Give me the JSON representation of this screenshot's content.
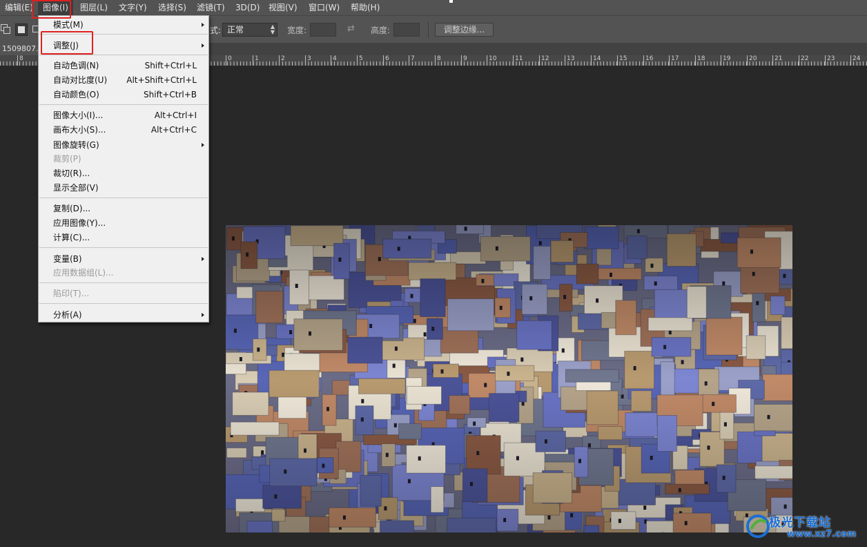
{
  "menubar": {
    "items": [
      "编辑(E)",
      "图像(I)",
      "图层(L)",
      "文字(Y)",
      "选择(S)",
      "滤镜(T)",
      "3D(D)",
      "视图(V)",
      "窗口(W)",
      "帮助(H)"
    ],
    "active_index": 1
  },
  "options": {
    "style_tail": "式:",
    "style_value": "正常",
    "width_label": "宽度:",
    "height_label": "高度:",
    "refine_edge": "调整边缘..."
  },
  "document": {
    "tab_title": "1509807..."
  },
  "ruler": {
    "numbers": [
      "8",
      "0",
      "1",
      "2",
      "3",
      "4",
      "5",
      "6",
      "7",
      "8",
      "9",
      "10",
      "11",
      "12",
      "13",
      "14",
      "15",
      "16",
      "17",
      "18",
      "19",
      "20",
      "21",
      "22",
      "23",
      "24"
    ]
  },
  "image_menu": {
    "mode": "模式(M)",
    "adjust": "调整(J)",
    "auto_tone": "自动色调(N)",
    "auto_tone_sc": "Shift+Ctrl+L",
    "auto_contrast": "自动对比度(U)",
    "auto_contrast_sc": "Alt+Shift+Ctrl+L",
    "auto_color": "自动颜色(O)",
    "auto_color_sc": "Shift+Ctrl+B",
    "image_size": "图像大小(I)...",
    "image_size_sc": "Alt+Ctrl+I",
    "canvas_size": "画布大小(S)...",
    "canvas_size_sc": "Alt+Ctrl+C",
    "rotation": "图像旋转(G)",
    "crop": "裁剪(P)",
    "trim": "裁切(R)...",
    "reveal_all": "显示全部(V)",
    "duplicate": "复制(D)...",
    "apply_image": "应用图像(Y)...",
    "calculations": "计算(C)...",
    "variables": "变量(B)",
    "apply_dataset": "应用数据组(L)...",
    "trap": "陷印(T)...",
    "analysis": "分析(A)"
  },
  "watermark": {
    "brand": "极光下载站",
    "url": "www.xz7.com"
  },
  "colors": {
    "highlight": "#e02020",
    "menubar_bg": "#535353",
    "workspace_bg": "#282828",
    "menu_bg": "#f0f0f0"
  }
}
